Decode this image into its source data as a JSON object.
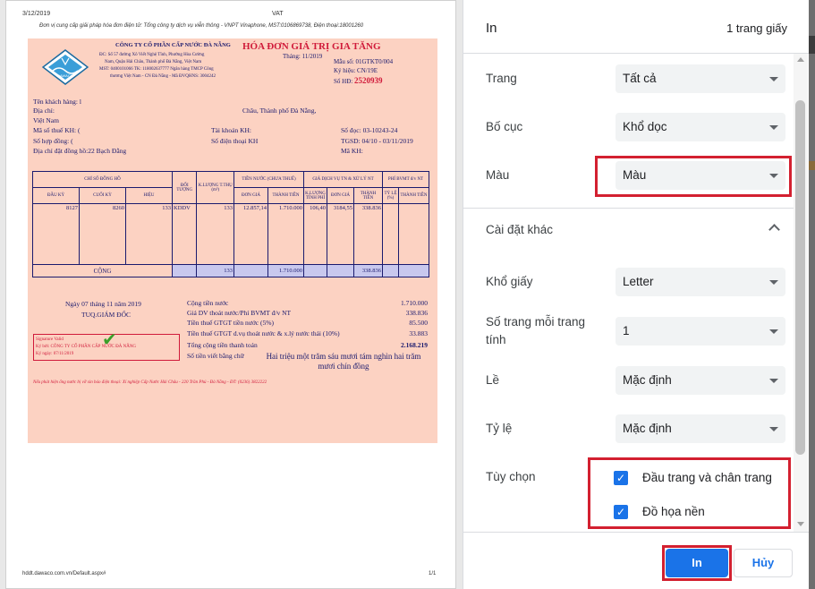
{
  "preview": {
    "date": "3/12/2019",
    "vat": "VAT",
    "provider_line": "Đơn vị cung cấp giải pháp hóa đơn điện tử: Tổng công ty dịch vụ viễn thông - VNPT Vinaphone, MST:0106869738, Điện thoại:18001260",
    "footer_url": "hddt.dawaco.com.vn/Default.aspx#",
    "footer_page": "1/1",
    "invoice": {
      "logo_text": "DAWACO",
      "company_name": "CÔNG TY CỔ PHẦN CẤP NƯỚC ĐÀ NẴNG",
      "company_lines": [
        "ĐC: Số 57 đường Xô Viết Nghệ Tĩnh, Phường Hòa Cường",
        "Nam, Quận Hải Châu, Thành phố Đà Nẵng, Việt Nam",
        "MST: 0400101066 TK: 118002637777 Ngân hàng TMCP Công",
        "thương Việt Nam - CN Đà Nẵng - Mã ĐVQHNS: 3004242"
      ],
      "title": "HÓA ĐƠN GIÁ TRỊ GIA TĂNG",
      "month": "Tháng: 11/2019",
      "form_no": "Mẫu số: 01GTKT0/004",
      "symbol": "Ký hiệu: CN/19E",
      "invoice_no_label": "Số HĐ:",
      "invoice_no": "2520939",
      "cust_name": "Tên khách hàng: l",
      "address_label": "Địa chỉ:",
      "address_tail": "Châu, Thành phố Đà Nẵng,",
      "country": "Việt Nam",
      "tax_code": "Mã số thuế KH: (",
      "account": "Tài khoản KH:",
      "reading_no": "Số đọc: 03-10243-24",
      "contract_no": "Số hợp đồng: (",
      "phone": "Số điện thoại KH",
      "period": "TGSD: 04/10 - 03/11/2019",
      "meter_addr": "Địa chỉ đặt đồng hồ:22 Bạch Đằng",
      "cust_code": "Mã KH:",
      "table": {
        "h_index": "CHỈ SỐ ĐỒNG HỒ",
        "h_object": "ĐỐI TƯỢNG",
        "h_qty": "K.LƯỢNG T.THỤ (m³)",
        "h_water": "TIỀN NƯỚC (CHƯA THUẾ)",
        "h_drain": "GIÁ DỊCH VỤ TN & XỬ LÝ NT",
        "h_fee": "PHÍ BVMT đ/v NT",
        "h_start": "ĐẦU KỲ",
        "h_end": "CUỐI KỲ",
        "h_diff": "HIỆU",
        "h_price": "ĐƠN GIÁ",
        "h_amount": "THÀNH TIỀN",
        "h_qty2": "K.LƯỢNG TÍNH PHÍ",
        "h_price2": "ĐƠN GIÁ",
        "h_amount2": "THÀNH TIỀN",
        "h_rate": "TỶ LỆ (%)",
        "h_amount3": "THÀNH TIỀN",
        "row": [
          "8127",
          "8260",
          "133",
          "KDDV",
          "133",
          "12.857,14",
          "1.710.000",
          "106,40",
          "3184,55",
          "338.836"
        ],
        "total_label": "CỘNG",
        "total_qty": "133",
        "total_amount": "1.710.000",
        "total_drain": "338.836"
      },
      "date_line": "Ngày 07 tháng 11 năm 2019",
      "director": "TUQ.GIÁM ĐỐC",
      "sig_title": "Signature Valid",
      "sig_by": "Ký bởi: CÔNG TY CỔ PHẦN CẤP NƯỚC ĐÀ NẴNG",
      "sig_date": "Ký ngày: 07/11/2019",
      "sum_labels": [
        "Cộng tiền nước",
        "Giá DV thoát nước/Phí BVMT đ/v NT",
        "Tiền thuế GTGT tiền nước (5%)",
        "Tiền thuế GTGT d.vụ thoát nước & x.lý nước thải (10%)",
        "Tổng cộng tiền thanh toán",
        "Số tiền viết bằng chữ"
      ],
      "sum_values": [
        "1.710.000",
        "338.836",
        "85.500",
        "33.883",
        "2.168.219"
      ],
      "words": "Hai triệu một trăm sáu mươi tám nghìn hai trăm mươi chín đồng",
      "note": "Nếu phát hiện ống nước bị vỡ xin báo điện thoại: Xí nghiệp Cấp Nước Hải Châu - 220 Trần Phú - Đà Nẵng - ĐT: (0236) 3822222"
    }
  },
  "settings": {
    "title": "In",
    "page_count": "1 trang giấy",
    "rows": {
      "pages_label": "Trang",
      "pages_value": "Tất cả",
      "layout_label": "Bố cục",
      "layout_value": "Khổ dọc",
      "color_label": "Màu",
      "color_value": "Màu",
      "more_label": "Cài đặt khác",
      "paper_label": "Khổ giấy",
      "paper_value": "Letter",
      "pps_label": "Số trang mỗi trang tính",
      "pps_value": "1",
      "margins_label": "Lề",
      "margins_value": "Mặc định",
      "scale_label": "Tỷ lệ",
      "scale_value": "Mặc định",
      "options_label": "Tùy chọn",
      "opt_headers": "Đầu trang và chân trang",
      "opt_bg": "Đồ họa nền"
    },
    "print_button": "In",
    "cancel_button": "Hủy"
  },
  "colors": {
    "accent": "#1a73e8",
    "highlight_frame": "#d32030",
    "invoice_bg": "#fcd2c2"
  }
}
